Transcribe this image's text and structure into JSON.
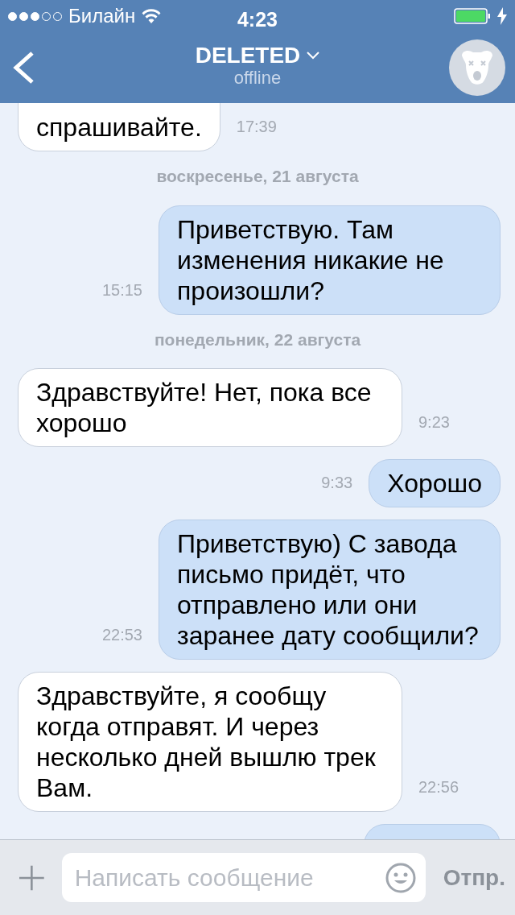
{
  "status_bar": {
    "carrier": "Билайн",
    "time": "4:23"
  },
  "header": {
    "title": "DELETED",
    "subtitle": "offline"
  },
  "messages": [
    {
      "kind": "incoming",
      "text": "спрашивайте.",
      "time": "17:39"
    },
    {
      "kind": "date",
      "text": "воскресенье, 21 августа"
    },
    {
      "kind": "outgoing",
      "text": "Приветствую. Там изменения никакие не произошли?",
      "time": "15:15"
    },
    {
      "kind": "date",
      "text": "понедельник, 22 августа"
    },
    {
      "kind": "incoming",
      "text": "Здравствуйте! Нет, пока все хорошо",
      "time": "9:23"
    },
    {
      "kind": "outgoing",
      "text": "Хорошо",
      "time": "9:33"
    },
    {
      "kind": "outgoing",
      "text": "Приветствую) С завода письмо придёт, что отправлено или они заранее дату сообщили?",
      "time": "22:53"
    },
    {
      "kind": "incoming",
      "text": "Здравствуйте, я сообщу когда отправят. И через несколько дней вышлю трек Вам.",
      "time": "22:56"
    },
    {
      "kind": "outgoing"
    }
  ],
  "composer": {
    "placeholder": "Написать сообщение",
    "send": "Отпр."
  }
}
